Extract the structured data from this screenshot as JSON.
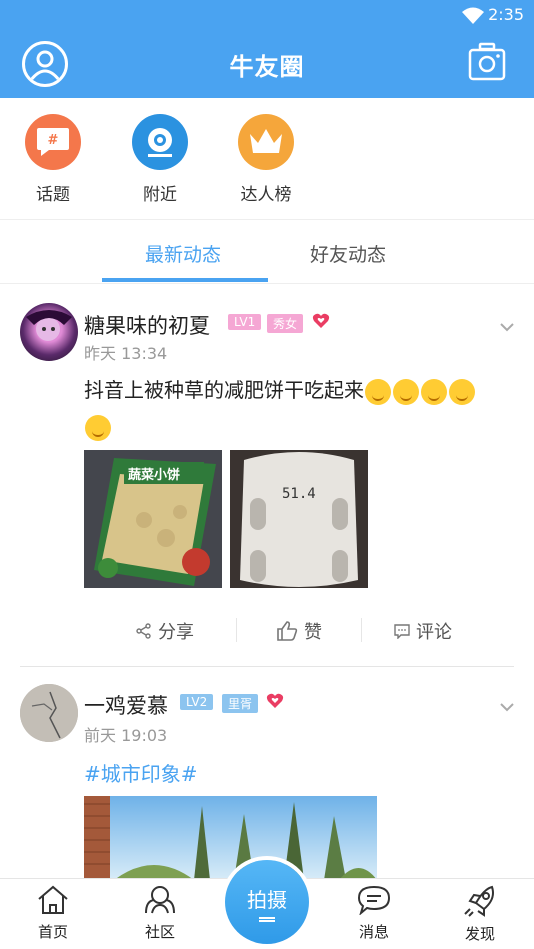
{
  "status": {
    "time": "2:35"
  },
  "header": {
    "title": "牛友圈"
  },
  "quick_links": [
    {
      "label": "话题"
    },
    {
      "label": "附近"
    },
    {
      "label": "达人榜"
    }
  ],
  "tabs": [
    {
      "label": "最新动态"
    },
    {
      "label": "好友动态"
    }
  ],
  "posts": [
    {
      "user": "糖果味的初夏",
      "level": "LV1",
      "tag": "秀女",
      "time": "昨天 13:34",
      "text": "抖音上被种草的减肥饼干吃起来",
      "image_1_text": "蔬菜小饼",
      "image_2_text": "51.4",
      "actions": {
        "share": "分享",
        "like": "赞",
        "comment": "评论"
      }
    },
    {
      "user": "一鸡爱慕",
      "level": "LV2",
      "tag": "里胥",
      "time": "前天 19:03",
      "topic": "#城市印象#"
    }
  ],
  "bottom_nav": {
    "home": "首页",
    "community": "社区",
    "shoot": "拍摄",
    "messages": "消息",
    "discover": "发现"
  },
  "colors": {
    "primary": "#4aa3f1",
    "level1": "#f5a7d4",
    "level2": "#8cc4ef",
    "heart": "#ea3d63"
  },
  "icons": [
    "wifi-icon",
    "user-avatar-icon",
    "camera-icon",
    "topic-icon",
    "nearby-icon",
    "crown-icon",
    "chevron-down-icon",
    "share-icon",
    "like-icon",
    "comment-icon",
    "home-icon",
    "community-icon",
    "message-icon",
    "rocket-icon"
  ]
}
